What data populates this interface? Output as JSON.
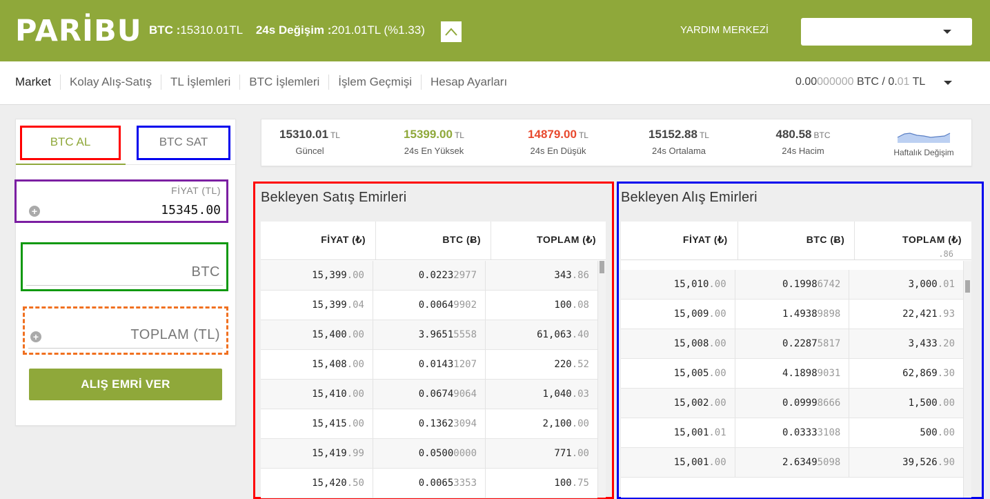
{
  "header": {
    "logo": "PARİBU",
    "ticker_label": "BTC :",
    "ticker_value": "15310.01TL",
    "change_label": "24s Değişim :",
    "change_value": "201.01TL (%1.33)",
    "help": "YARDIM MERKEZİ"
  },
  "nav": {
    "items": [
      "Market",
      "Kolay Alış-Satış",
      "TL İşlemleri",
      "BTC İşlemleri",
      "İşlem Geçmişi",
      "Hesap Ayarları"
    ],
    "balance_btc_main": "0.00",
    "balance_btc_dim": "000000",
    "balance_btc_unit": " BTC / 0.",
    "balance_tl_dim": "01",
    "balance_tl_unit": " TL"
  },
  "order_form": {
    "tab_buy": "BTC AL",
    "tab_sell": "BTC SAT",
    "price_label": "FİYAT (TL)",
    "price_value": "15345.00",
    "amount_label": "BTC",
    "total_label": "TOPLAM (TL)",
    "submit": "ALIŞ EMRİ VER"
  },
  "stats": {
    "current": {
      "value": "15310.01",
      "unit": "TL",
      "caption": "Güncel"
    },
    "high": {
      "value": "15399.00",
      "unit": "TL",
      "caption": "24s En Yüksek"
    },
    "low": {
      "value": "14879.00",
      "unit": "TL",
      "caption": "24s En Düşük"
    },
    "avg": {
      "value": "15152.88",
      "unit": "TL",
      "caption": "24s Ortalama"
    },
    "volume": {
      "value": "480.58",
      "unit": "BTC",
      "caption": "24s Hacim"
    },
    "weekly_caption": "Haftalık Değişim"
  },
  "sell_book": {
    "title": "Bekleyen Satış Emirleri",
    "headers": [
      "FİYAT (₺)",
      "BTC (Ƀ)",
      "TOPLAM (₺)"
    ],
    "rows": [
      [
        [
          "15,399",
          ".00"
        ],
        [
          "0.0223",
          "2977"
        ],
        [
          "343",
          ".86"
        ]
      ],
      [
        [
          "15,399",
          ".04"
        ],
        [
          "0.0064",
          "9902"
        ],
        [
          "100",
          ".08"
        ]
      ],
      [
        [
          "15,400",
          ".00"
        ],
        [
          "3.9651",
          "5558"
        ],
        [
          "61,063",
          ".40"
        ]
      ],
      [
        [
          "15,408",
          ".00"
        ],
        [
          "0.0143",
          "1207"
        ],
        [
          "220",
          ".52"
        ]
      ],
      [
        [
          "15,410",
          ".00"
        ],
        [
          "0.0674",
          "9064"
        ],
        [
          "1,040",
          ".03"
        ]
      ],
      [
        [
          "15,415",
          ".00"
        ],
        [
          "0.1362",
          "3094"
        ],
        [
          "2,100",
          ".00"
        ]
      ],
      [
        [
          "15,419",
          ".99"
        ],
        [
          "0.0500",
          "0000"
        ],
        [
          "771",
          ".00"
        ]
      ],
      [
        [
          "15,420",
          ".50"
        ],
        [
          "0.0065",
          "3353"
        ],
        [
          "100",
          ".75"
        ]
      ]
    ]
  },
  "buy_book": {
    "title": "Bekleyen Alış Emirleri",
    "headers": [
      "FİYAT (₺)",
      "BTC (Ƀ)",
      "TOPLAM (₺)"
    ],
    "peek": ".86",
    "rows": [
      [
        [
          "15,010",
          ".00"
        ],
        [
          "0.1998",
          "6742"
        ],
        [
          "3,000",
          ".01"
        ]
      ],
      [
        [
          "15,009",
          ".00"
        ],
        [
          "1.4938",
          "9898"
        ],
        [
          "22,421",
          ".93"
        ]
      ],
      [
        [
          "15,008",
          ".00"
        ],
        [
          "0.2287",
          "5817"
        ],
        [
          "3,433",
          ".20"
        ]
      ],
      [
        [
          "15,005",
          ".00"
        ],
        [
          "4.1898",
          "9031"
        ],
        [
          "62,869",
          ".30"
        ]
      ],
      [
        [
          "15,002",
          ".00"
        ],
        [
          "0.0999",
          "8666"
        ],
        [
          "1,500",
          ".00"
        ]
      ],
      [
        [
          "15,001",
          ".01"
        ],
        [
          "0.0333",
          "3108"
        ],
        [
          "500",
          ".00"
        ]
      ],
      [
        [
          "15,001",
          ".00"
        ],
        [
          "2.6349",
          "5098"
        ],
        [
          "39,526",
          ".90"
        ]
      ]
    ]
  },
  "colors": {
    "brand": "#8fa83a",
    "high": "#8fa83a",
    "low": "#e8492e"
  },
  "icons": {
    "up": "chevron-up-icon",
    "dropdown": "caret-down-icon",
    "plus": "plus-circle-icon",
    "sparkline": "sparkline-icon"
  }
}
